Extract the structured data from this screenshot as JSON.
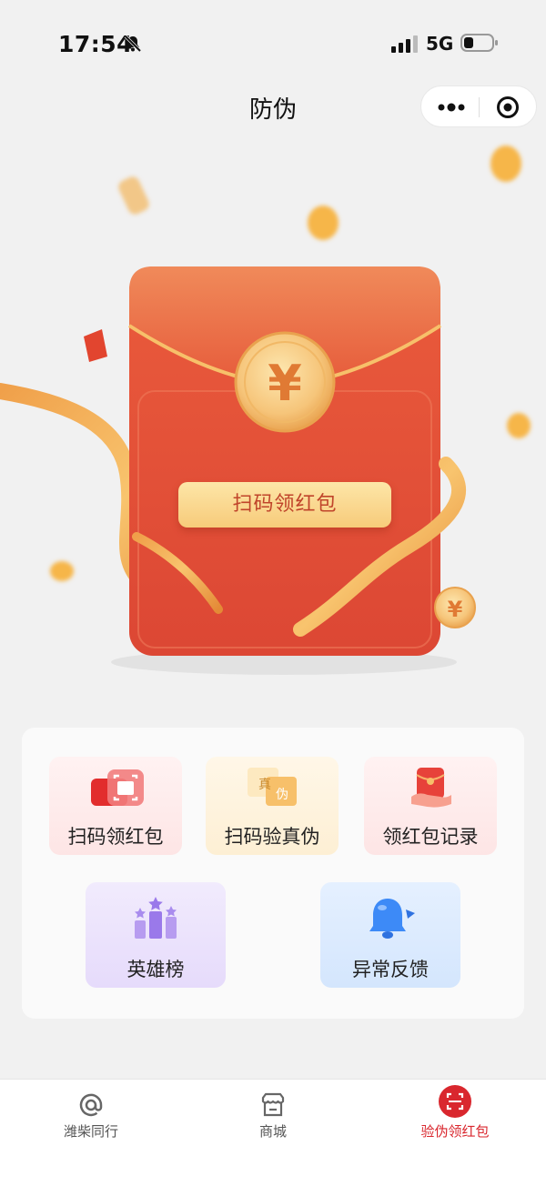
{
  "status_bar": {
    "time": "17:54",
    "network": "5G"
  },
  "nav": {
    "title": "防伪"
  },
  "hero": {
    "button_label": "扫码领红包"
  },
  "menu": {
    "items": [
      {
        "label": "扫码领红包",
        "icon": "scan-redpacket-icon"
      },
      {
        "label": "扫码验真伪",
        "icon": "verify-authenticity-icon"
      },
      {
        "label": "领红包记录",
        "icon": "redpacket-record-icon"
      },
      {
        "label": "英雄榜",
        "icon": "leaderboard-icon"
      },
      {
        "label": "异常反馈",
        "icon": "feedback-bell-icon"
      }
    ],
    "verify_icon_text": [
      "真",
      "伪"
    ]
  },
  "tabbar": {
    "items": [
      {
        "label": "潍柴同行",
        "icon": "at-icon",
        "active": false
      },
      {
        "label": "商城",
        "icon": "store-icon",
        "active": false
      },
      {
        "label": "验伪领红包",
        "icon": "scan-icon",
        "active": true
      }
    ]
  },
  "colors": {
    "accent": "#d9272e",
    "envelope": "#e04b33",
    "gold": "#f7cb7a"
  }
}
